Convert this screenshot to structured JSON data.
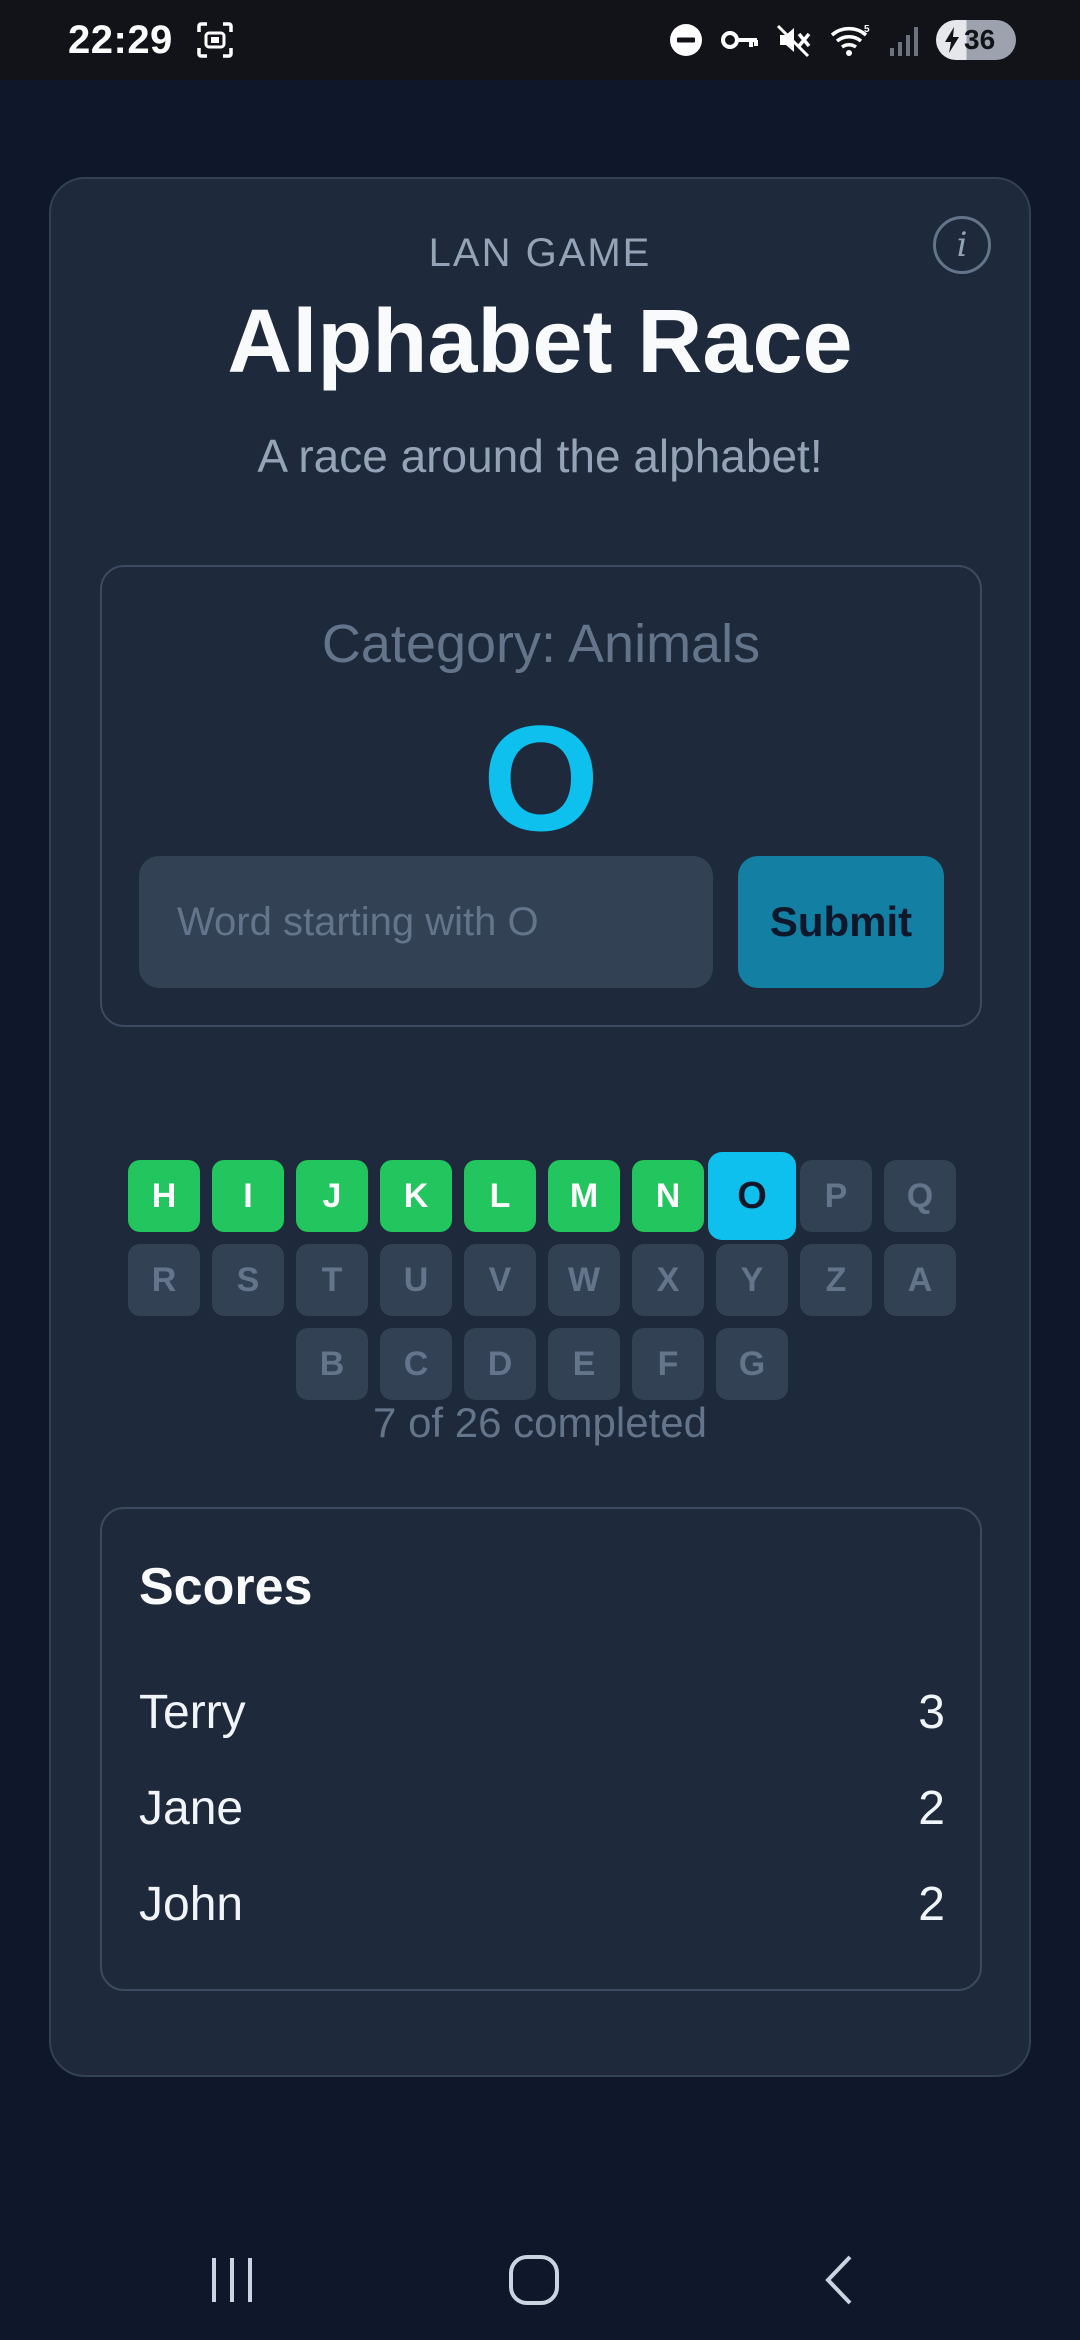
{
  "status_bar": {
    "time": "22:29",
    "icons": [
      "screenshot-icon",
      "dnd-icon",
      "vpn-key-icon",
      "mute-icon",
      "wifi-icon",
      "signal-icon"
    ],
    "battery": "36"
  },
  "header": {
    "eyebrow": "LAN GAME",
    "title": "Alphabet Race",
    "subtitle": "A race around the alphabet!",
    "info_icon": "i"
  },
  "round": {
    "category": "Category: Animals",
    "current_letter": "O",
    "input_placeholder": "Word starting with O",
    "input_value": "",
    "submit_label": "Submit"
  },
  "letters": [
    {
      "letter": "H",
      "state": "done"
    },
    {
      "letter": "I",
      "state": "done"
    },
    {
      "letter": "J",
      "state": "done"
    },
    {
      "letter": "K",
      "state": "done"
    },
    {
      "letter": "L",
      "state": "done"
    },
    {
      "letter": "M",
      "state": "done"
    },
    {
      "letter": "N",
      "state": "done"
    },
    {
      "letter": "O",
      "state": "current"
    },
    {
      "letter": "P",
      "state": "pending"
    },
    {
      "letter": "Q",
      "state": "pending"
    },
    {
      "letter": "R",
      "state": "pending"
    },
    {
      "letter": "S",
      "state": "pending"
    },
    {
      "letter": "T",
      "state": "pending"
    },
    {
      "letter": "U",
      "state": "pending"
    },
    {
      "letter": "V",
      "state": "pending"
    },
    {
      "letter": "W",
      "state": "pending"
    },
    {
      "letter": "X",
      "state": "pending"
    },
    {
      "letter": "Y",
      "state": "pending"
    },
    {
      "letter": "Z",
      "state": "pending"
    },
    {
      "letter": "A",
      "state": "pending"
    },
    {
      "letter": "B",
      "state": "pending"
    },
    {
      "letter": "C",
      "state": "pending"
    },
    {
      "letter": "D",
      "state": "pending"
    },
    {
      "letter": "E",
      "state": "pending"
    },
    {
      "letter": "F",
      "state": "pending"
    },
    {
      "letter": "G",
      "state": "pending"
    }
  ],
  "progress_text": "7 of 26 completed",
  "scores": {
    "title": "Scores",
    "players": [
      {
        "name": "Terry",
        "score": "3"
      },
      {
        "name": "Jane",
        "score": "2"
      },
      {
        "name": "John",
        "score": "2"
      }
    ]
  },
  "colors": {
    "background": "#0f172a",
    "card": "#1e293b",
    "accent": "#0ec0ee",
    "done": "#22c55e",
    "pending": "#334155",
    "submit": "#137fa3"
  },
  "nav": {
    "icons": [
      "recent-apps-icon",
      "home-icon",
      "back-icon"
    ]
  }
}
